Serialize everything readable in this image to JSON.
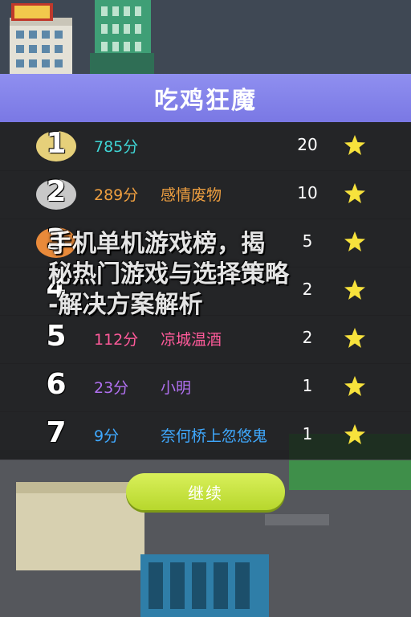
{
  "game": {
    "title": "吃鸡狂魔",
    "continue_label": "继续",
    "sign_text": "",
    "leaderboard": [
      {
        "rank": "1",
        "score": "785分",
        "name": "",
        "count": "20",
        "badge": "#e6d07a",
        "score_color": "#3fd6d6",
        "name_color": "#3fd6d6"
      },
      {
        "rank": "2",
        "score": "289分",
        "name": "感情废物",
        "count": "10",
        "badge": "#c8c8c8",
        "score_color": "#f0a040",
        "name_color": "#f0a040"
      },
      {
        "rank": "3",
        "score": "",
        "name": "",
        "count": "5",
        "badge": "#e98a3a",
        "score_color": "#e05050",
        "name_color": "#e05050"
      },
      {
        "rank": "4",
        "score": "",
        "name": "",
        "count": "2",
        "badge": "none",
        "score_color": "#f0d040",
        "name_color": "#f0d040"
      },
      {
        "rank": "5",
        "score": "112分",
        "name": "凉城温酒",
        "count": "2",
        "badge": "none",
        "score_color": "#ff5a9a",
        "name_color": "#ff5a9a"
      },
      {
        "rank": "6",
        "score": "23分",
        "name": "小明",
        "count": "1",
        "badge": "none",
        "score_color": "#b070f0",
        "name_color": "#b070f0"
      },
      {
        "rank": "7",
        "score": "9分",
        "name": "奈何桥上忽悠鬼",
        "count": "1",
        "badge": "none",
        "score_color": "#3fa9ff",
        "name_color": "#3fa9ff"
      }
    ],
    "star_color": "#f7e23c"
  },
  "watermark": {
    "line1": "手机单机游戏榜，揭",
    "line2": "秘热门游戏与选择策略",
    "line3": "-解决方案解析"
  }
}
